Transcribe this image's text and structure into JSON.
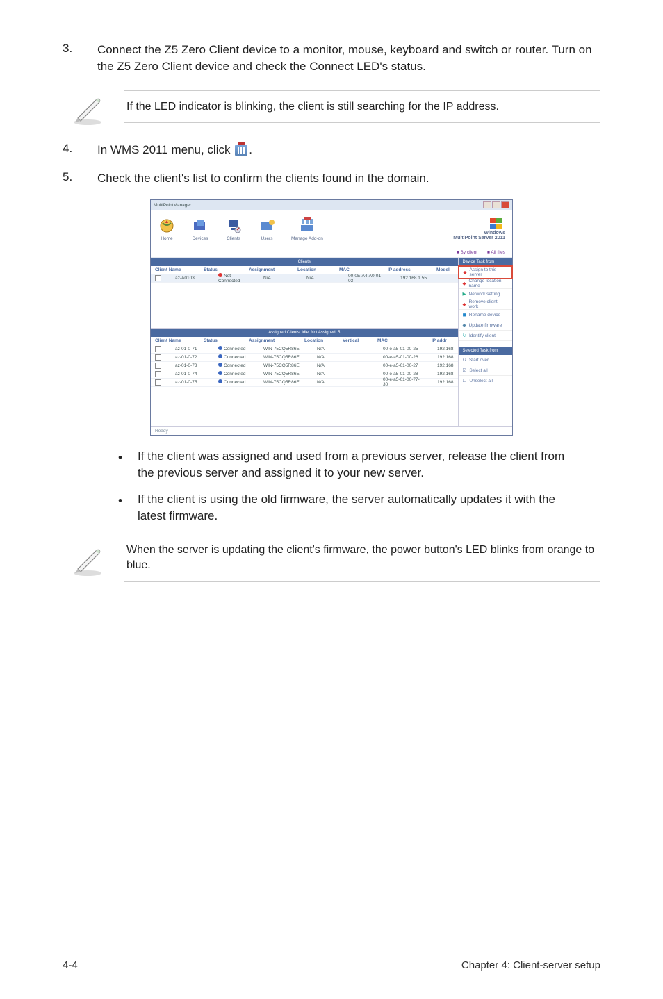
{
  "steps": {
    "s3": {
      "num": "3.",
      "text": "Connect the Z5 Zero Client device to a monitor, mouse, keyboard and switch or router. Turn on the Z5 Zero Client device and check the Connect LED's status."
    },
    "s4": {
      "num": "4.",
      "text_before": "In WMS 2011 menu, click ",
      "text_after": "."
    },
    "s5": {
      "num": "5.",
      "text": "Check the client's list to confirm the clients found in the domain."
    }
  },
  "note1": "If the LED indicator is blinking, the client is still searching for the IP address.",
  "note2": "When the server is updating the client's firmware, the power button's LED blinks from orange to blue.",
  "bullet1": "If the client was assigned and used from a previous server, release the client from the previous server and assigned it to your new server.",
  "bullet2": "If the client is using the old firmware, the server automatically updates it with the latest firmware.",
  "footer_left": "4-4",
  "footer_right": "Chapter 4: Client-server setup",
  "mock": {
    "title": "MultiPointManager",
    "tb": [
      "Home",
      "Devices",
      "Clients",
      "Users",
      "Manage Add-on"
    ],
    "brand1": "Windows",
    "brand2": "MultiPoint Server 2011",
    "status": [
      "By client",
      "All files"
    ],
    "hdr1": "Clients",
    "top_cols": [
      "Client Name",
      "Status",
      "Assignment",
      "Location",
      "MAC",
      "IP address",
      "Model"
    ],
    "top_row": [
      "az-A0103",
      "Not Connected",
      "N/A",
      "N/A",
      "00-0E-A4-A0-01-03",
      "192.168.1.55",
      ""
    ],
    "hdr2": "Assigned Clients: Idle; Not Assigned: 5",
    "bot_cols": [
      "Client Name",
      "Status",
      "Assignment",
      "Location",
      "Vertical",
      "MAC",
      "IP addr"
    ],
    "rows": [
      [
        "az-01-0-71",
        "Connected",
        "WIN-75CQ5R86E",
        "N/A",
        "",
        "00-e-a5-01-00-25",
        "192.168"
      ],
      [
        "az-01-0-72",
        "Connected",
        "WIN-75CQ5R86E",
        "N/A",
        "",
        "00-e-a5-01-00-26",
        "192.168"
      ],
      [
        "az-01-0-73",
        "Connected",
        "WIN-75CQ5R86E",
        "N/A",
        "",
        "00-e-a5-01-00-27",
        "192.168"
      ],
      [
        "az-01-0-74",
        "Connected",
        "WIN-75CQ5R86E",
        "N/A",
        "",
        "00-e-a5-01-00-28",
        "192.168"
      ],
      [
        "az-01-0-75",
        "Connected",
        "WIN-75CQ5R86E",
        "N/A",
        "",
        "00-e-a5-01-00-77-30",
        "192.168"
      ]
    ],
    "side_hdr1": "Device Task from",
    "side_items1": [
      "Assign to this server",
      "Change location name",
      "Network setting",
      "Remove client work",
      "Rename device",
      "Update firmware",
      "Identify client"
    ],
    "side_hdr2": "Selected Task from",
    "side_items2": [
      "Start over",
      "Select all",
      "Unselect all"
    ],
    "footer": "Ready"
  }
}
